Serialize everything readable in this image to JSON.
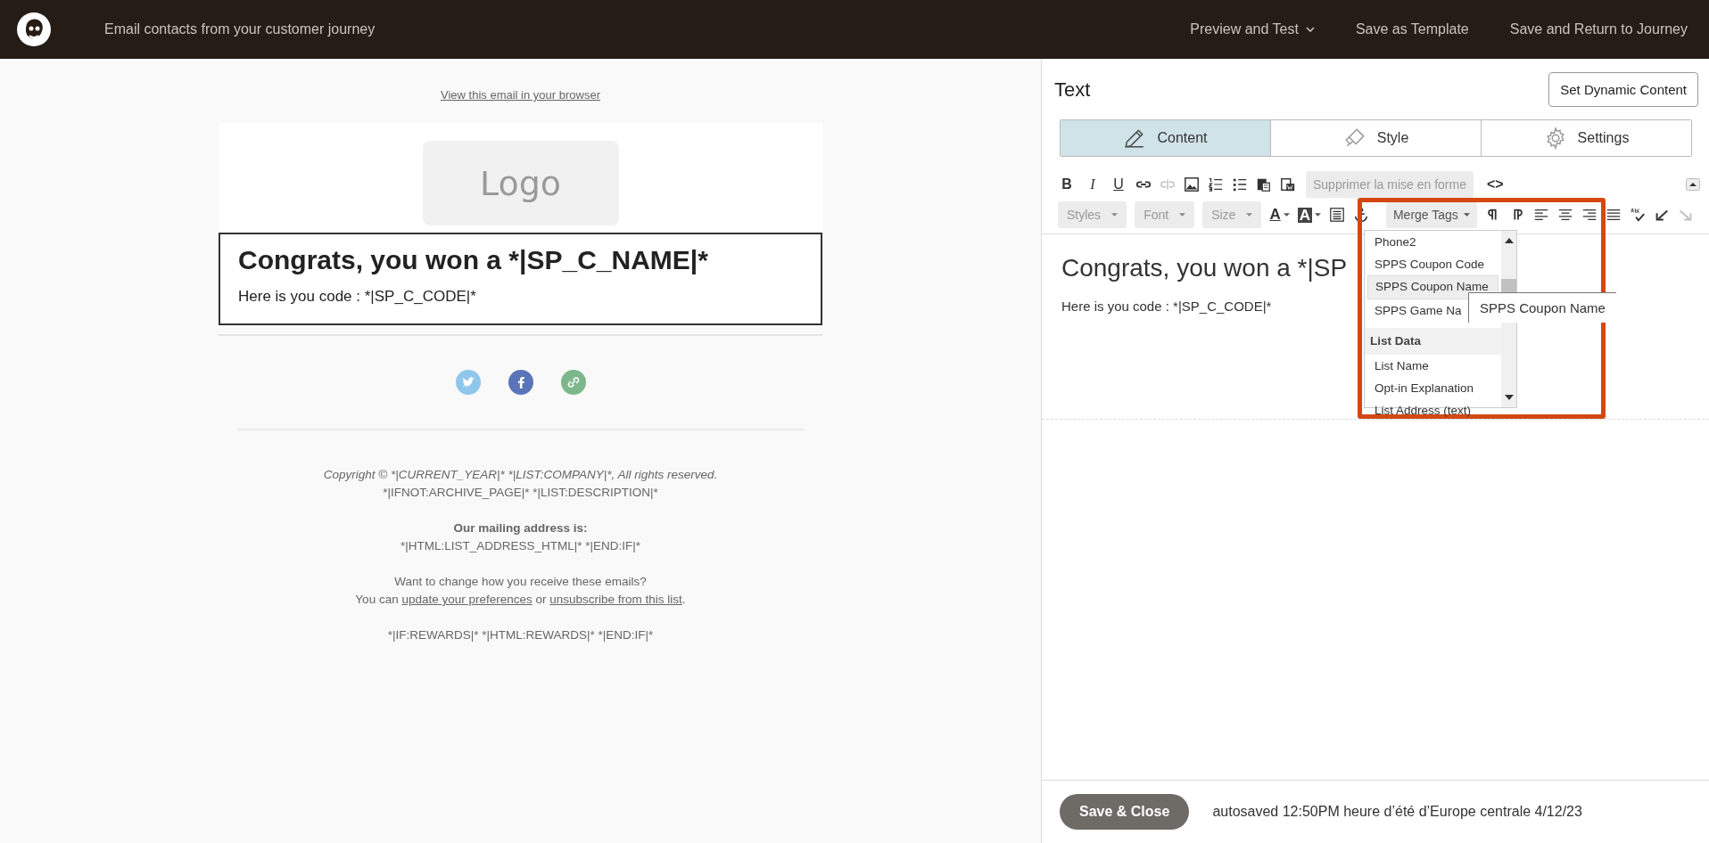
{
  "app_bar": {
    "title": "Email contacts from your customer journey",
    "actions": [
      {
        "label": "Preview and Test",
        "kind": "menu"
      },
      {
        "label": "Save as Template",
        "kind": "link"
      },
      {
        "label": "Save and Return to Journey",
        "kind": "link"
      }
    ]
  },
  "preview": {
    "browser_link": "View this email in your browser",
    "logo": "Logo",
    "heading": "Congrats, you won a *|SP_C_NAME|*",
    "body": "Here is you code : *|SP_C_CODE|*",
    "footer": {
      "copyright": "Copyright © *|CURRENT_YEAR|* *|LIST:COMPANY|*, All rights reserved.",
      "description": "*|IFNOT:ARCHIVE_PAGE|* *|LIST:DESCRIPTION|*",
      "address_heading": "Our mailing address is:",
      "address": "*|HTML:LIST_ADDRESS_HTML|* *|END:IF|*",
      "change_question": "Want to change how you receive these emails?",
      "change_sentence": {
        "before": "You can ",
        "link_1": "update your preferences",
        "middle": " or ",
        "link_2": "unsubscribe from this list",
        "after": "."
      },
      "rewards": "*|IF:REWARDS|* *|HTML:REWARDS|* *|END:IF|*"
    }
  },
  "editor": {
    "title": "Text",
    "dynamic_button": "Set Dynamic Content",
    "tabs": [
      {
        "label": "Content",
        "selected": true
      },
      {
        "label": "Style",
        "selected": false
      },
      {
        "label": "Settings",
        "selected": false
      }
    ],
    "toolbar": {
      "format_letters": [
        "B",
        "I",
        "U"
      ],
      "unlink": {
        "disabled": true
      },
      "remove_format": "Supprimer la mise en forme",
      "source": "<>",
      "dropdowns": [
        "Styles",
        "Font",
        "Size"
      ],
      "text_color": "A",
      "highlight_color": "A",
      "merge_tags": "Merge Tags",
      "redo": {
        "disabled": true
      }
    },
    "content": {
      "heading": "Congrats, you won a *|SP",
      "body": "Here is you code : *|SP_C_CODE|*"
    },
    "merge_menu": {
      "items": [
        {
          "kind": "item",
          "label": "Phone2",
          "selected": false
        },
        {
          "kind": "item",
          "label": "SPPS Coupon Code",
          "selected": false
        },
        {
          "kind": "item",
          "label": "SPPS Coupon Name",
          "selected": true
        },
        {
          "kind": "item",
          "label": "SPPS Game Na",
          "selected": false
        },
        {
          "kind": "header",
          "label": "List Data"
        },
        {
          "kind": "item",
          "label": "List Name",
          "selected": false
        },
        {
          "kind": "item",
          "label": "Opt-in Explanation",
          "selected": false
        },
        {
          "kind": "item",
          "label": "List Address (text)",
          "selected": false
        }
      ],
      "tooltip": "SPPS Coupon Name"
    }
  },
  "footer_bar": {
    "save_button": "Save & Close",
    "autosave": "autosaved 12:50PM heure d’été d’Europe centrale 4/12/23"
  }
}
